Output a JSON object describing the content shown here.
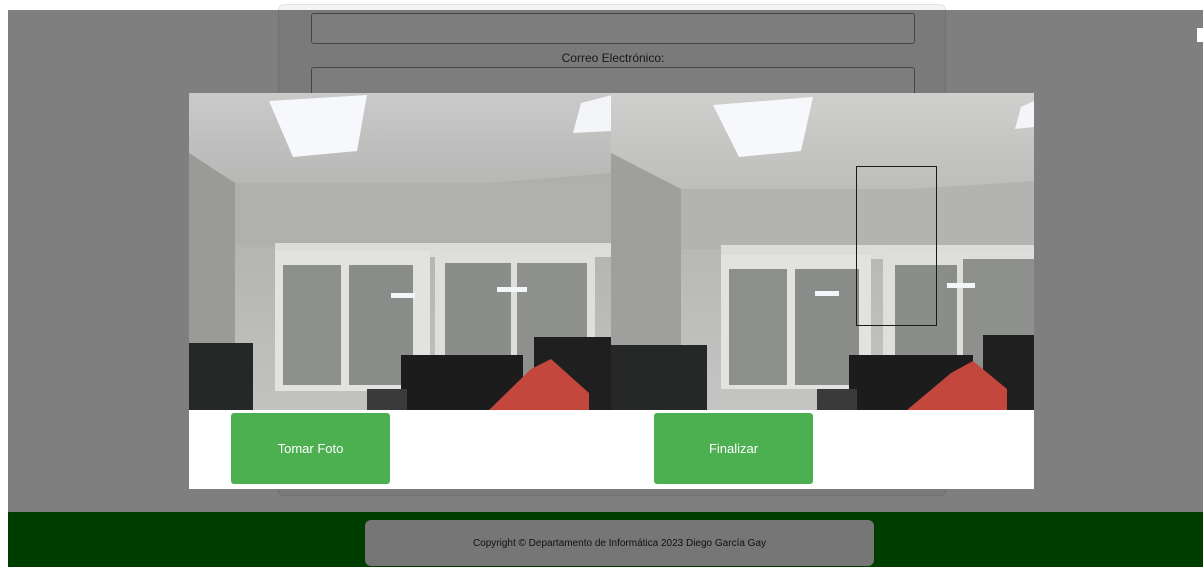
{
  "form": {
    "email_label": "Correo Electrónico:",
    "email_value": "",
    "top_value": ""
  },
  "modal": {
    "capture_button": "Tomar Foto",
    "finish_button": "Finalizar"
  },
  "footer": {
    "copyright": "Copyright © Departamento de Informática 2023 Diego García Gay"
  },
  "colors": {
    "accent_green": "#4caf50",
    "footer_green": "#007d00",
    "overlay": "rgba(0,0,0,0.5)"
  }
}
